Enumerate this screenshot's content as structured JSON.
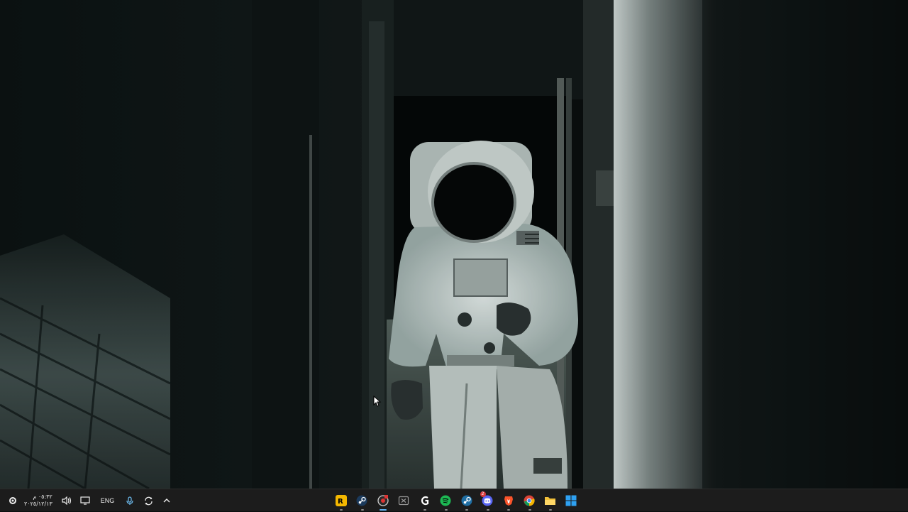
{
  "taskbar": {
    "clock": {
      "time": "٠٥:٣٢ م",
      "date": "٢٠٢٥/١٢/١٣"
    },
    "language": "ENG",
    "tray_icons": [
      "settings-gear-icon",
      "volume-icon",
      "display-icon",
      "microphone-icon",
      "sync-icon",
      "chevron-up-icon"
    ],
    "apps": [
      {
        "name": "rockstar-games",
        "indicator": "dot"
      },
      {
        "name": "steam",
        "indicator": "dot"
      },
      {
        "name": "screen-recorder",
        "indicator": "active"
      },
      {
        "name": "xbox-app",
        "indicator": "none"
      },
      {
        "name": "g-hub",
        "indicator": "dot"
      },
      {
        "name": "spotify",
        "indicator": "dot"
      },
      {
        "name": "steam-2",
        "indicator": "dot"
      },
      {
        "name": "discord",
        "indicator": "dot",
        "badge": "2"
      },
      {
        "name": "brave",
        "indicator": "dot"
      },
      {
        "name": "chrome",
        "indicator": "dot"
      },
      {
        "name": "file-explorer",
        "indicator": "dot"
      },
      {
        "name": "start",
        "indicator": "none"
      }
    ],
    "colors": {
      "background": "#1c1c1c",
      "active_indicator": "#5fb2f2",
      "rockstar": "#f5b800",
      "spotify": "#1db954",
      "discord": "#5865f2",
      "brave": "#fb542b",
      "explorer": "#f3c13a",
      "windows": "#2ea1f2"
    }
  }
}
